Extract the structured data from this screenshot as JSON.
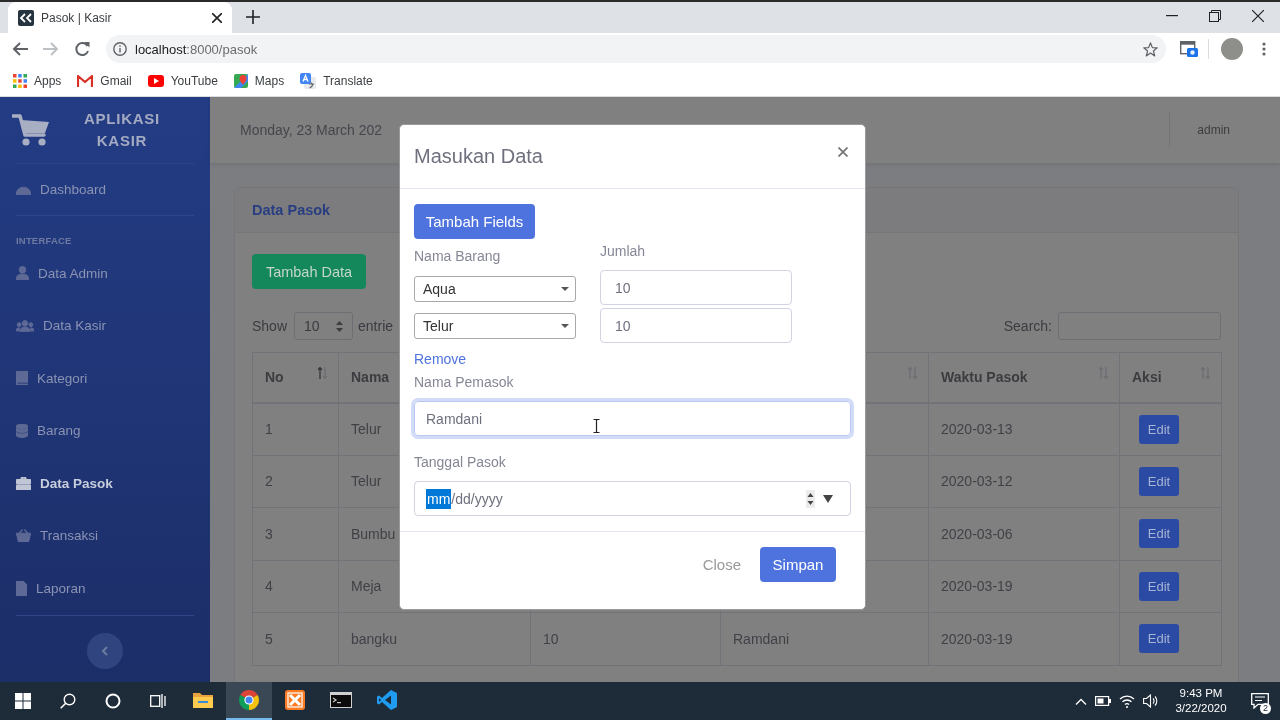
{
  "browser": {
    "tabs": [
      {
        "title": "Pasok | Kasir",
        "selected": true
      }
    ],
    "url": {
      "host": "localhost",
      "rest": ":8000/pasok"
    },
    "bookmarks": [
      "Apps",
      "Gmail",
      "YouTube",
      "Maps",
      "Translate"
    ]
  },
  "sidebar": {
    "brand": "APLIKASI KASIR",
    "sections": [
      {
        "items": [
          {
            "label": "Dashboard",
            "selected": false
          }
        ]
      },
      {
        "heading": "INTERFACE",
        "items": [
          {
            "label": "Data Admin",
            "selected": false
          },
          {
            "label": "Data Kasir",
            "selected": false
          },
          {
            "label": "Kategori",
            "selected": false
          },
          {
            "label": "Barang",
            "selected": false
          },
          {
            "label": "Data Pasok",
            "selected": true
          },
          {
            "label": "Transaksi",
            "selected": false
          },
          {
            "label": "Laporan",
            "selected": false
          }
        ]
      }
    ]
  },
  "topbar": {
    "date": "Monday, 23 March 202",
    "user": "admin"
  },
  "card": {
    "title": "Data Pasok",
    "add_button": "Tambah Data",
    "length_menu": {
      "label": "Show",
      "value": "10",
      "suffix": "entrie"
    },
    "search": {
      "label": "Search:"
    },
    "table": {
      "columns": [
        {
          "label": "No",
          "sorted": true
        },
        {
          "label": "Nama"
        },
        null,
        {
          "sorted": false
        },
        {
          "label": "Waktu Pasok",
          "sorted": false
        },
        {
          "label": "Aksi",
          "sorted": false
        }
      ],
      "rows": [
        {
          "cells": [
            "1",
            "Telur",
            null,
            null,
            "2020-03-13"
          ],
          "action": "Edit"
        },
        {
          "cells": [
            "2",
            "Telur",
            null,
            null,
            "2020-03-12"
          ],
          "action": "Edit"
        },
        {
          "cells": [
            "3",
            "Bumbu",
            null,
            null,
            "2020-03-06"
          ],
          "action": "Edit"
        },
        {
          "cells": [
            "4",
            "Meja",
            null,
            null,
            "2020-03-19"
          ],
          "action": "Edit"
        },
        {
          "cells": [
            "5",
            "bangku",
            "10",
            "Ramdani",
            "2020-03-19"
          ],
          "action": "Edit"
        }
      ]
    }
  },
  "modal": {
    "title": "Masukan Data",
    "add_fields_button": "Tambah Fields",
    "product_label": "Nama Barang",
    "qty_label": "Jumlah",
    "items": [
      {
        "product": "Aqua",
        "qty": "10"
      },
      {
        "product": "Telur",
        "qty": "10"
      }
    ],
    "remove_link": "Remove",
    "supplier": {
      "label": "Nama Pemasok",
      "value": "Ramdani",
      "focused": true
    },
    "date": {
      "label": "Tanggal Pasok",
      "segments": [
        {
          "text": "mm",
          "selected": true
        },
        {
          "text": "/dd/yyyy",
          "selected": false
        }
      ]
    },
    "buttons": [
      {
        "label": "Close",
        "kind": "link"
      },
      {
        "label": "Simpan",
        "kind": "primary"
      }
    ]
  },
  "taskbar": {
    "apps": [
      {
        "selected": false
      },
      {
        "selected": true
      },
      {
        "selected": false
      },
      {
        "selected": false
      },
      {
        "selected": false
      }
    ],
    "clock": {
      "time": "9:43 PM",
      "date": "3/22/2020"
    },
    "notifications": "2"
  }
}
